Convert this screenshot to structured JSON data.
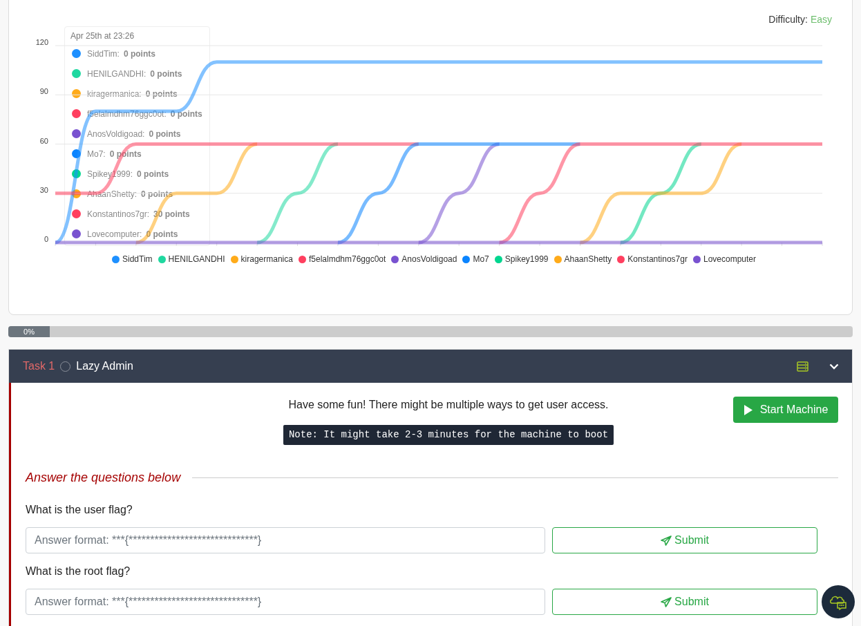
{
  "difficulty": {
    "label": "Difficulty:",
    "value": "Easy"
  },
  "chart": {
    "chart_data": {
      "type": "line",
      "grid": true,
      "legend": "bottom",
      "ylim": [
        0,
        120
      ],
      "yticks": [
        0,
        30,
        60,
        90,
        120
      ],
      "series": [
        {
          "name": "SiddTim",
          "color": "#1e90ff",
          "values": [
            0,
            80,
            80,
            80,
            110,
            110,
            110,
            110,
            110,
            110,
            110,
            110,
            110,
            110,
            110,
            110,
            110,
            110,
            110,
            110
          ]
        },
        {
          "name": "HENILGANDHI",
          "color": "#1fd8a0",
          "values": [
            null,
            null,
            null,
            null,
            null,
            0,
            30,
            60,
            null,
            null,
            null,
            null,
            null,
            null,
            null,
            null,
            null,
            null,
            null,
            null
          ]
        },
        {
          "name": "kiragermanica",
          "color": "#ffab1a",
          "values": [
            null,
            null,
            0,
            30,
            30,
            60,
            null,
            null,
            null,
            null,
            null,
            null,
            null,
            null,
            null,
            null,
            null,
            null,
            null,
            null
          ]
        },
        {
          "name": "f5elalmdhm76ggc0ot",
          "color": "#ff3f5f",
          "values": [
            30,
            30,
            60,
            60,
            60,
            60,
            60,
            60,
            60,
            60,
            null,
            null,
            null,
            null,
            null,
            null,
            null,
            null,
            null,
            null
          ]
        },
        {
          "name": "AnosVoldigoad",
          "color": "#7952d0",
          "values": [
            null,
            null,
            null,
            null,
            null,
            null,
            null,
            null,
            null,
            0,
            30,
            60,
            null,
            null,
            null,
            null,
            null,
            null,
            null,
            null
          ]
        },
        {
          "name": "Mo7",
          "color": "#0a84ff",
          "values": [
            null,
            null,
            null,
            null,
            null,
            null,
            null,
            0,
            30,
            60,
            60,
            60,
            60,
            60,
            null,
            null,
            null,
            null,
            null,
            null
          ]
        },
        {
          "name": "Spikey1999",
          "color": "#00d68f",
          "values": [
            null,
            null,
            null,
            null,
            null,
            null,
            null,
            null,
            null,
            null,
            null,
            null,
            null,
            null,
            0,
            30,
            60,
            null,
            null,
            null
          ]
        },
        {
          "name": "AhaanShetty",
          "color": "#ffab1a",
          "values": [
            null,
            null,
            null,
            null,
            null,
            null,
            null,
            null,
            null,
            null,
            null,
            null,
            null,
            0,
            30,
            30,
            30,
            60,
            null,
            null
          ]
        },
        {
          "name": "Konstantinos7gr",
          "color": "#ff3f5f",
          "values": [
            null,
            null,
            null,
            null,
            null,
            null,
            null,
            null,
            null,
            null,
            null,
            0,
            30,
            60,
            60,
            60,
            60,
            60,
            60,
            60
          ]
        },
        {
          "name": "Lovecomputer",
          "color": "#7952d0",
          "values": [
            0,
            0,
            0,
            0,
            0,
            0,
            0,
            0,
            0,
            0,
            0,
            0,
            0,
            0,
            0,
            0,
            0,
            0,
            0,
            0
          ]
        }
      ]
    },
    "tooltip": {
      "title": "Apr 25th at 23:26",
      "items": [
        {
          "label": "SiddTim:",
          "value": "0 points",
          "color": "#1e90ff"
        },
        {
          "label": "HENILGANDHI:",
          "value": "0 points",
          "color": "#1fd8a0"
        },
        {
          "label": "kiragermanica:",
          "value": "0 points",
          "color": "#ffab1a"
        },
        {
          "label": "f5elalmdhm76ggc0ot:",
          "value": "0 points",
          "color": "#ff3f5f"
        },
        {
          "label": "AnosVoldigoad:",
          "value": "0 points",
          "color": "#7952d0"
        },
        {
          "label": "Mo7:",
          "value": "0 points",
          "color": "#0a84ff"
        },
        {
          "label": "Spikey1999:",
          "value": "0 points",
          "color": "#00d68f"
        },
        {
          "label": "AhaanShetty:",
          "value": "0 points",
          "color": "#ffab1a"
        },
        {
          "label": "Konstantinos7gr:",
          "value": "30 points",
          "color": "#ff3f5f"
        },
        {
          "label": "Lovecomputer:",
          "value": "0 points",
          "color": "#7952d0"
        }
      ]
    }
  },
  "progress": {
    "label": "0%",
    "level": 0
  },
  "task": {
    "number": "Task 1",
    "completed": false,
    "title": "Lazy Admin",
    "expanded": true,
    "description": "Have some fun! There might be multiple ways to get user access.",
    "note": "Note: It might take 2-3 minutes for the machine to boot",
    "start_button": "Start Machine",
    "questions_heading": "Answer the questions below",
    "questions": [
      {
        "question": "What is the user flag?",
        "placeholder": "Answer format: ***{******************************}",
        "button": "Submit"
      },
      {
        "question": "What is the root flag?",
        "placeholder": "Answer format: ***{******************************}",
        "button": "Submit"
      }
    ]
  }
}
